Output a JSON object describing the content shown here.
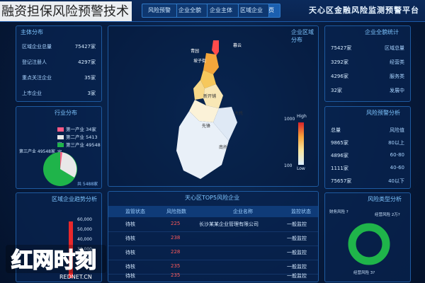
{
  "caption": "融资担保风险预警技术",
  "header": {
    "title": "天心区金融风险监测预警平台",
    "tabs": [
      {
        "label": "首页",
        "active": true
      },
      {
        "label": "区域企业"
      },
      {
        "label": "企业主体"
      },
      {
        "label": "企业全貌"
      },
      {
        "label": "风险预警"
      }
    ]
  },
  "map": {
    "title": "企业区域分布",
    "labels": [
      "暮云",
      "青园",
      "坡子街",
      "大托",
      "新开铺",
      "南托",
      "先锋"
    ],
    "scale": {
      "high": "1000",
      "low": "100",
      "high_label": "High",
      "low_label": "Low"
    }
  },
  "left_panel": {
    "title": "主体分布",
    "rows": [
      {
        "k": "区域企业总量",
        "v": "75427家"
      },
      {
        "k": "登记注册人",
        "v": "4297家"
      },
      {
        "k": "重点关注企业",
        "v": "35家"
      },
      {
        "k": "上市企业",
        "v": "3家"
      }
    ]
  },
  "pie_panel": {
    "title": "行业分布",
    "legend": [
      "第一产业 34家",
      "第二产业 5413家",
      "第三产业 49548家"
    ],
    "legend_colors": [
      "#ff5b86",
      "#e8e8e8",
      "#1fb44a"
    ],
    "side_label": "第三产业 49548家",
    "bottom_label": "共 5488家"
  },
  "bar_panel": {
    "title": "区域企业趋势分析",
    "ticks": [
      "60,000",
      "50,000",
      "40,000",
      "30,000",
      "20,000"
    ]
  },
  "right_top": {
    "title": "企业全貌统计",
    "rows": [
      {
        "v": "区域总量",
        "k": "75427家"
      },
      {
        "v": "经营类",
        "k": "3292家"
      },
      {
        "v": "服务类",
        "k": "4296家"
      },
      {
        "v": "发展中",
        "k": "32家"
      }
    ]
  },
  "right_mid": {
    "title": "风险预警分析",
    "rows": [
      {
        "v": "总量",
        "k": "风险值"
      },
      {
        "v": "9865家",
        "k": "80以上"
      },
      {
        "v": "4896家",
        "k": "60-80"
      },
      {
        "v": "1111家",
        "k": "40-60"
      },
      {
        "v": "75657家",
        "k": "40以下"
      }
    ]
  },
  "right_bottom": {
    "title": "风险类型分析",
    "labels": [
      "财务风险 ?",
      "经营风险 2万?",
      "经营风险 3?"
    ],
    "donut_colors": [
      "#1fb44a",
      "#0d2f5e"
    ]
  },
  "table": {
    "title": "天心区TOP5风险企业",
    "headers": [
      "监控状态",
      "企业名称",
      "风险指数",
      "监管状态"
    ],
    "rows": [
      {
        "status": "一般监控",
        "name": "长沙某某企业管理有限公司",
        "score": "225",
        "state": "待核"
      },
      {
        "status": "一般监控",
        "name": "",
        "score": "238",
        "state": "待核"
      },
      {
        "status": "一般监控",
        "name": "",
        "score": "228",
        "state": "待核"
      },
      {
        "status": "一般监控",
        "name": "",
        "score": "235",
        "state": "待核"
      },
      {
        "status": "一般监控",
        "name": "",
        "score": "235",
        "state": "待核"
      }
    ]
  },
  "watermark": {
    "text": "红网时刻",
    "sub": "REDNET.CN"
  }
}
